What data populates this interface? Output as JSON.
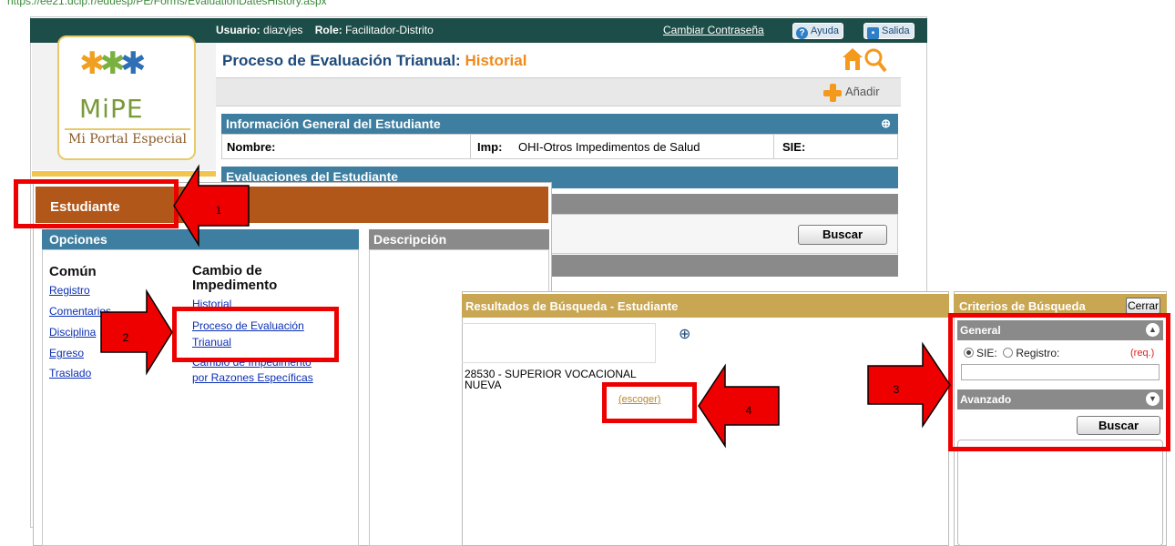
{
  "url": {
    "visible": "https://ee21.dcip.r/eduesp/PE/Forms/EvaluationDatesHistory.aspx"
  },
  "topbar": {
    "user_label": "Usuario:",
    "user_value": "diazvjes",
    "role_label": "Role:",
    "role_value": "Facilitador-Distrito",
    "change_password": "Cambiar Contraseña",
    "help": "Ayuda",
    "exit": "Salida"
  },
  "logo": {
    "main": "MiPE",
    "sub": "Mi Portal Especial"
  },
  "page": {
    "title_main": "Proceso de Evaluación Trianual:",
    "title_highlight": "Historial",
    "add_label": "Añadir"
  },
  "student_info": {
    "header": "Información General del Estudiante",
    "name_label": "Nombre:",
    "imp_label": "Imp:",
    "imp_value": "OHI-Otros Impedimentos de Salud",
    "sie_label": "SIE:"
  },
  "evaluations": {
    "header": "Evaluaciones del Estudiante",
    "search_button": "Buscar"
  },
  "menu": {
    "title": "Estudiante",
    "options_header": "Opciones",
    "description_header": "Descripción",
    "common": {
      "heading": "Común",
      "links": [
        "Registro",
        "Comentarios",
        "Disciplina",
        "Egreso",
        "Traslado"
      ]
    },
    "impairment": {
      "heading_line1": "Cambio de",
      "heading_line2": "Impedimento",
      "links": [
        "Historial",
        "Proceso de Evaluación",
        "Trianual",
        "Cambio de Impedimento",
        "por Razones Específicas"
      ]
    }
  },
  "results": {
    "header": "Resultados de Búsqueda - Estudiante",
    "line1": "28530 - SUPERIOR VOCACIONAL",
    "line2": "NUEVA",
    "choose": "(escoger)"
  },
  "criteria": {
    "header": "Criterios de Búsqueda",
    "close": "Cerrar",
    "general": "General",
    "sie": "SIE:",
    "registro": "Registro:",
    "required": "(req.)",
    "advanced": "Avanzado",
    "search": "Buscar",
    "selected_option": "SIE"
  },
  "annotations": [
    "1",
    "2",
    "3",
    "4"
  ],
  "colors": {
    "topbar": "#1d4d48",
    "blue_header": "#3e7ea0",
    "student_bar": "#b2571a",
    "gold_header": "#c9a651",
    "title_orange": "#f08a1b",
    "annotation_red": "#ee0000"
  }
}
